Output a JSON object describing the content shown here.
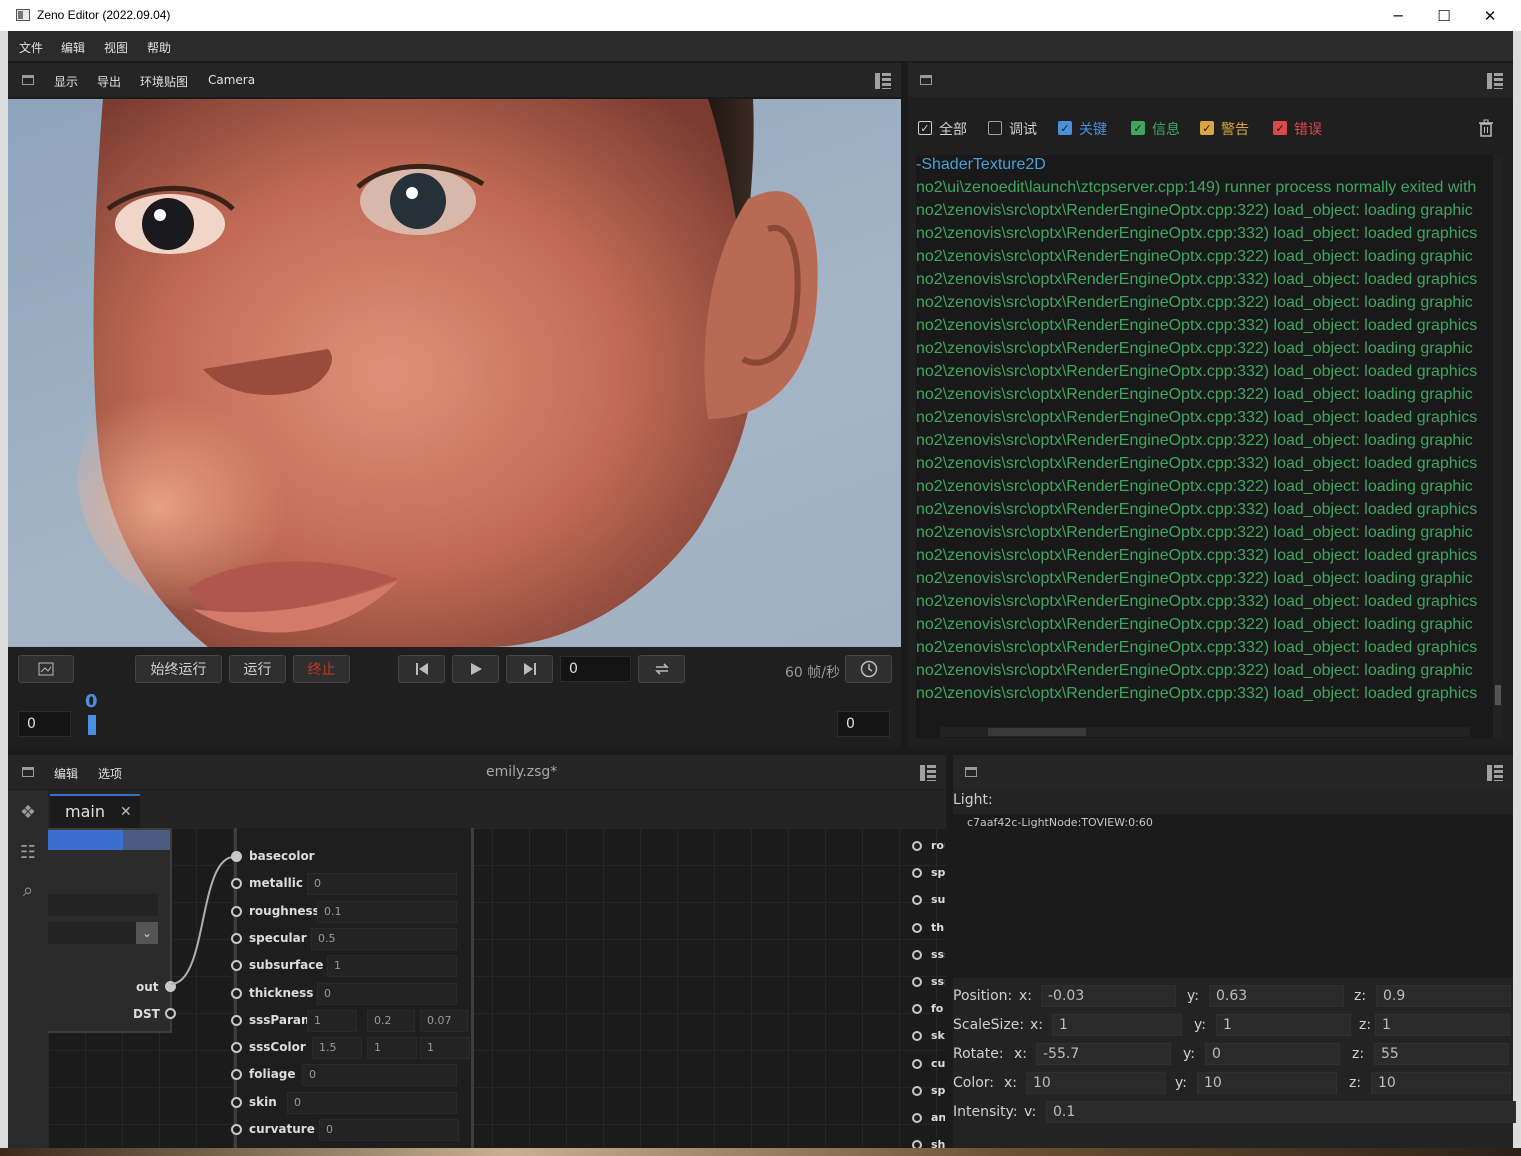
{
  "window": {
    "title": "Zeno Editor (2022.09.04)",
    "controls": [
      "─",
      "☐",
      "✕"
    ]
  },
  "menu": {
    "items": [
      "文件",
      "编辑",
      "视图",
      "帮助"
    ]
  },
  "viewport_panel": {
    "tools": [
      "显示",
      "导出",
      "环境贴图",
      "Camera"
    ],
    "buttons": {
      "always_run": "始终运行",
      "run": "运行",
      "stop": "终止"
    },
    "frame_input": "0",
    "fps": "60 帧/秒",
    "timeline": {
      "start": "0",
      "end": "0",
      "current": "0"
    }
  },
  "log_panel": {
    "filters": [
      {
        "label": "全部",
        "checked": true,
        "color": "#d0d0d0"
      },
      {
        "label": "调试",
        "checked": false,
        "color": "#d0d0d0"
      },
      {
        "label": "关键",
        "checked": true,
        "color": "#4a8fd9"
      },
      {
        "label": "信息",
        "checked": true,
        "color": "#3fa65f"
      },
      {
        "label": "警告",
        "checked": true,
        "color": "#d9a441"
      },
      {
        "label": "错误",
        "checked": true,
        "color": "#d94a4a"
      }
    ],
    "lines": [
      {
        "text": "-ShaderTexture2D",
        "color": "#4a9fd9"
      },
      {
        "text": "no2\\ui\\zenoedit\\launch\\ztcpserver.cpp:149) runner process normally exited with"
      },
      {
        "text": "no2\\zenovis\\src\\optx\\RenderEngineOptx.cpp:322) load_object: loading graphic"
      },
      {
        "text": "no2\\zenovis\\src\\optx\\RenderEngineOptx.cpp:332) load_object: loaded graphics"
      },
      {
        "text": "no2\\zenovis\\src\\optx\\RenderEngineOptx.cpp:322) load_object: loading graphic"
      },
      {
        "text": "no2\\zenovis\\src\\optx\\RenderEngineOptx.cpp:332) load_object: loaded graphics"
      },
      {
        "text": "no2\\zenovis\\src\\optx\\RenderEngineOptx.cpp:322) load_object: loading graphic"
      },
      {
        "text": "no2\\zenovis\\src\\optx\\RenderEngineOptx.cpp:332) load_object: loaded graphics"
      },
      {
        "text": "no2\\zenovis\\src\\optx\\RenderEngineOptx.cpp:322) load_object: loading graphic"
      },
      {
        "text": "no2\\zenovis\\src\\optx\\RenderEngineOptx.cpp:332) load_object: loaded graphics"
      },
      {
        "text": "no2\\zenovis\\src\\optx\\RenderEngineOptx.cpp:322) load_object: loading graphic"
      },
      {
        "text": "no2\\zenovis\\src\\optx\\RenderEngineOptx.cpp:332) load_object: loaded graphics"
      },
      {
        "text": "no2\\zenovis\\src\\optx\\RenderEngineOptx.cpp:322) load_object: loading graphic"
      },
      {
        "text": "no2\\zenovis\\src\\optx\\RenderEngineOptx.cpp:332) load_object: loaded graphics"
      },
      {
        "text": "no2\\zenovis\\src\\optx\\RenderEngineOptx.cpp:322) load_object: loading graphic"
      },
      {
        "text": "no2\\zenovis\\src\\optx\\RenderEngineOptx.cpp:332) load_object: loaded graphics"
      },
      {
        "text": "no2\\zenovis\\src\\optx\\RenderEngineOptx.cpp:322) load_object: loading graphic"
      },
      {
        "text": "no2\\zenovis\\src\\optx\\RenderEngineOptx.cpp:332) load_object: loaded graphics"
      },
      {
        "text": "no2\\zenovis\\src\\optx\\RenderEngineOptx.cpp:322) load_object: loading graphic"
      },
      {
        "text": "no2\\zenovis\\src\\optx\\RenderEngineOptx.cpp:332) load_object: loaded graphics"
      },
      {
        "text": "no2\\zenovis\\src\\optx\\RenderEngineOptx.cpp:322) load_object: loading graphic"
      },
      {
        "text": "no2\\zenovis\\src\\optx\\RenderEngineOptx.cpp:332) load_object: loaded graphics"
      },
      {
        "text": "no2\\zenovis\\src\\optx\\RenderEngineOptx.cpp:322) load_object: loading graphic"
      },
      {
        "text": "no2\\zenovis\\src\\optx\\RenderEngineOptx.cpp:332) load_object: loaded graphics"
      }
    ]
  },
  "graph_panel": {
    "tools": [
      "编辑",
      "选项"
    ],
    "file_title": "emily.zsg*",
    "tab": {
      "label": "main",
      "close": "✕"
    },
    "left_node": {
      "outputs": [
        "out",
        "DST"
      ]
    },
    "material_node": {
      "params": [
        {
          "name": "basecolor",
          "values": []
        },
        {
          "name": "metallic",
          "values": [
            "0"
          ]
        },
        {
          "name": "roughness",
          "values": [
            "0.1"
          ]
        },
        {
          "name": "specular",
          "values": [
            "0.5"
          ]
        },
        {
          "name": "subsurface",
          "values": [
            "1"
          ]
        },
        {
          "name": "thickness",
          "values": [
            "0"
          ]
        },
        {
          "name": "sssParam",
          "values": [
            "1",
            "0.2",
            "0.07"
          ]
        },
        {
          "name": "sssColor",
          "values": [
            "1.5",
            "1",
            "1"
          ]
        },
        {
          "name": "foliage",
          "values": [
            "0"
          ]
        },
        {
          "name": "skin",
          "values": [
            "0"
          ]
        },
        {
          "name": "curvature",
          "values": [
            "0"
          ]
        }
      ]
    },
    "right_node_ports": [
      "rou",
      "sp",
      "su",
      "thi",
      "sss",
      "sss",
      "fo",
      "sk",
      "cu",
      "sp",
      "an",
      "sh"
    ]
  },
  "light_panel": {
    "heading": "Light:",
    "node_id": "c7aaf42c-LightNode:TOVIEW:0:60",
    "props": [
      {
        "label": "Position:",
        "fields": [
          {
            "axis": "x:",
            "value": "-0.03"
          },
          {
            "axis": "y:",
            "value": "0.63"
          },
          {
            "axis": "z:",
            "value": "0.9"
          }
        ]
      },
      {
        "label": "ScaleSize:",
        "fields": [
          {
            "axis": "x:",
            "value": "1"
          },
          {
            "axis": "y:",
            "value": "1"
          },
          {
            "axis": "z:",
            "value": "1"
          }
        ]
      },
      {
        "label": "Rotate:",
        "fields": [
          {
            "axis": "x:",
            "value": "-55.7"
          },
          {
            "axis": "y:",
            "value": "0"
          },
          {
            "axis": "z:",
            "value": "55"
          }
        ]
      },
      {
        "label": "Color:",
        "fields": [
          {
            "axis": "x:",
            "value": "10"
          },
          {
            "axis": "y:",
            "value": "10"
          },
          {
            "axis": "z:",
            "value": "10"
          }
        ]
      },
      {
        "label": "Intensity:",
        "fields": [
          {
            "axis": "v:",
            "value": "0.1"
          }
        ]
      }
    ]
  }
}
